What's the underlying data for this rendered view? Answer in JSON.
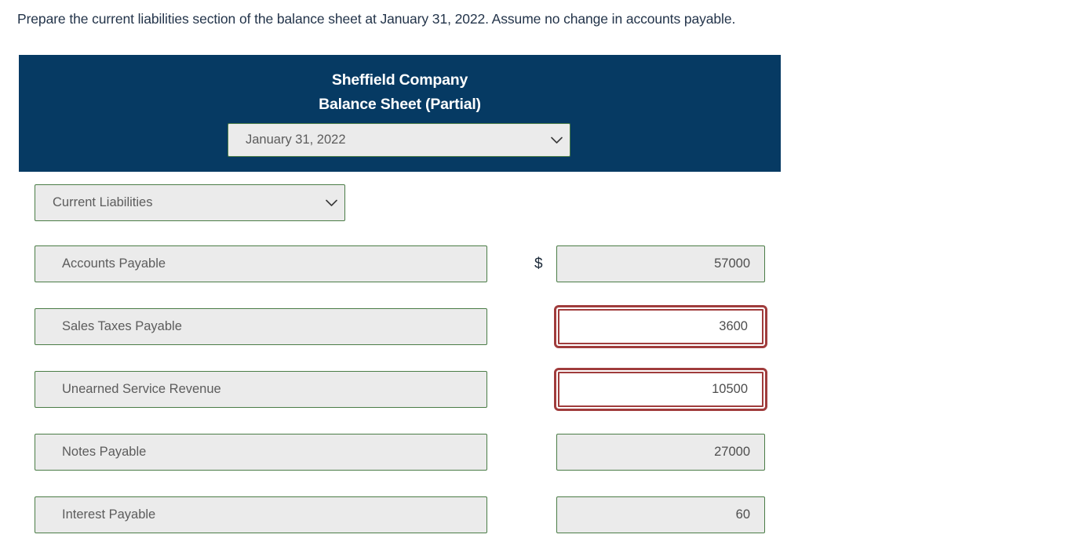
{
  "instruction": "Prepare the current liabilities section of the balance sheet at January 31, 2022. Assume no change in accounts payable.",
  "colors": {
    "header_navy": "#063a63",
    "field_border_green": "#4a7c46",
    "field_fill_gray": "#ebebeb",
    "error_red": "#a03c3c",
    "label_text": "#5c5c5c",
    "instruction_text": "#23344a"
  },
  "statement_header": {
    "company": "Sheffield Company",
    "title": "Balance Sheet (Partial)",
    "date_select": {
      "value": "January 31, 2022",
      "icon": "chevron-down-icon"
    }
  },
  "section_select": {
    "value": "Current Liabilities",
    "icon": "chevron-down-icon"
  },
  "currency_symbol": "$",
  "rows": [
    {
      "label": "Accounts Payable",
      "amount": "57000",
      "show_currency": true,
      "state": "normal"
    },
    {
      "label": "Sales Taxes Payable",
      "amount": "3600",
      "show_currency": false,
      "state": "error"
    },
    {
      "label": "Unearned Service Revenue",
      "amount": "10500",
      "show_currency": false,
      "state": "error"
    },
    {
      "label": "Notes Payable",
      "amount": "27000",
      "show_currency": false,
      "state": "normal"
    },
    {
      "label": "Interest Payable",
      "amount": "60",
      "show_currency": false,
      "state": "normal"
    }
  ]
}
